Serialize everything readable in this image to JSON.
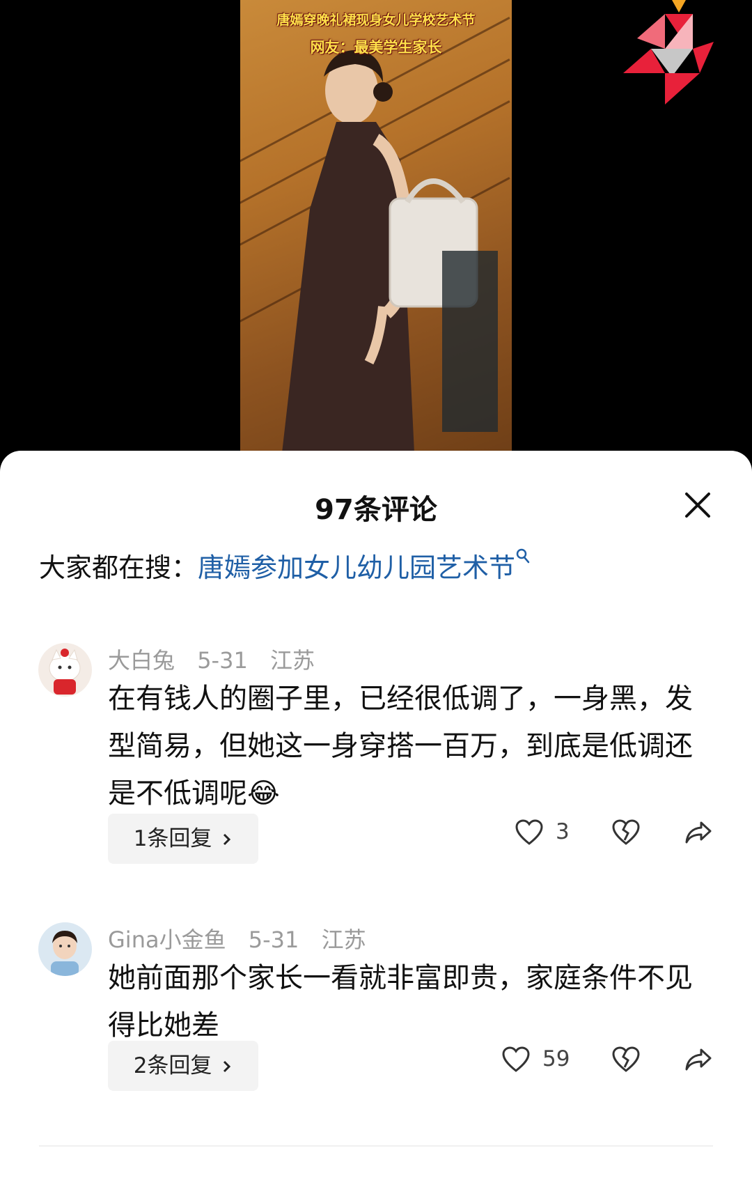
{
  "video": {
    "caption_line1": "唐嫣穿晚礼裙现身女儿学校艺术节",
    "caption_line2": "网友：最美学生家长"
  },
  "sheet": {
    "title": "97条评论",
    "search_prefix": "大家都在搜：",
    "search_term": "唐嫣参加女儿幼儿园艺术节"
  },
  "comments": [
    {
      "username": "大白兔",
      "date": "5-31",
      "location": "江苏",
      "text": "在有钱人的圈子里，已经很低调了，一身黑，发型简易，但她这一身穿搭一百万，到底是低调还是不低调呢",
      "emoji": "😂",
      "reply_label": "1条回复",
      "like_count": "3"
    },
    {
      "username": "Gina小金鱼",
      "date": "5-31",
      "location": "江苏",
      "text": "她前面那个家长一看就非富即贵，家庭条件不见得比她差",
      "reply_label": "2条回复",
      "like_count": "59"
    }
  ],
  "colors": {
    "link": "#1f5fa6",
    "caption": "#ffe14a",
    "logo_red": "#e8213a"
  }
}
